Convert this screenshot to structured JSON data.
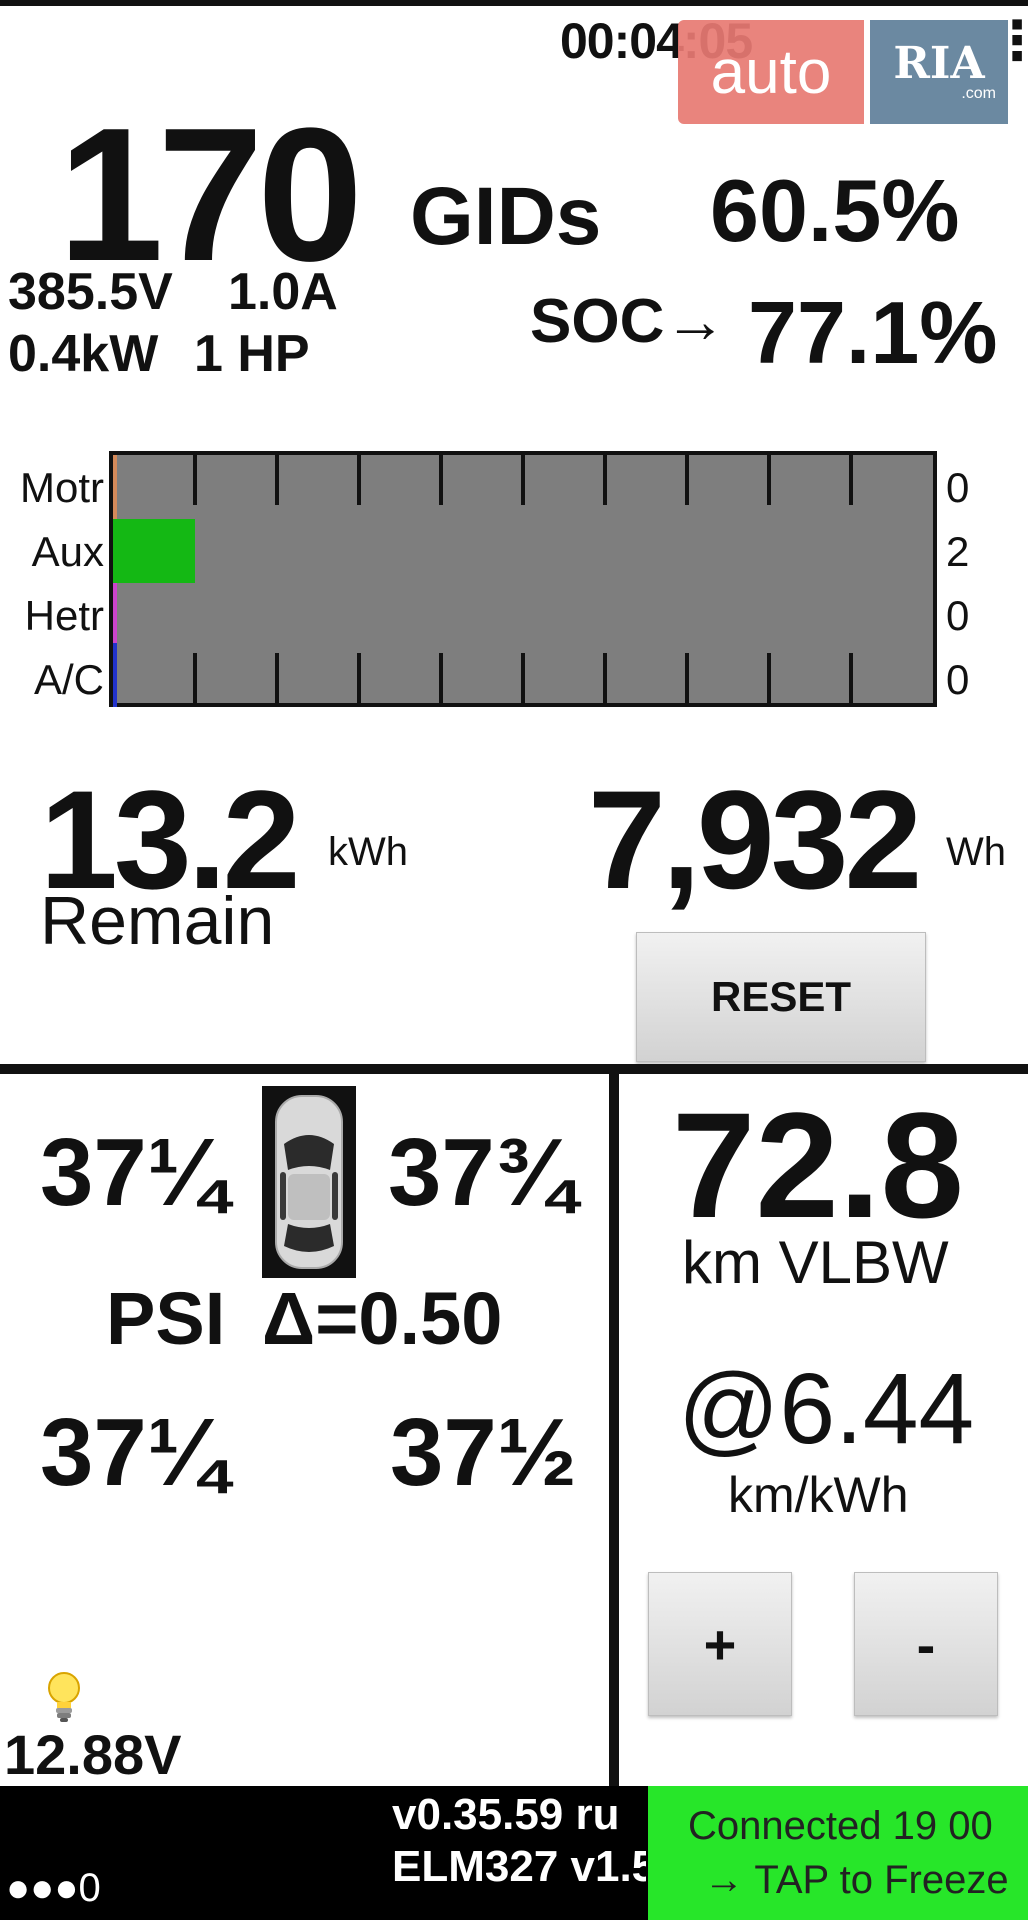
{
  "header": {
    "clock": "00:04:05",
    "menu_icon": "more-vert-icon",
    "watermark": {
      "left": "auto",
      "right": "RIA",
      "suffix": ".com"
    }
  },
  "battery": {
    "gids_value": "170",
    "gids_unit": "GIDs",
    "percent": "60.5%",
    "voltage": "385.5V",
    "current": "1.0A",
    "power_kw": "0.4kW",
    "power_hp": "1 HP",
    "soc_label": "SOC→",
    "soc_value": "77.1%"
  },
  "power_bars": {
    "rows": [
      {
        "label": "Motr",
        "value": "0",
        "fraction": 0.0,
        "color": "#d48a5a"
      },
      {
        "label": "Aux",
        "value": "2",
        "fraction": 0.1,
        "color": "#14b814"
      },
      {
        "label": "Hetr",
        "value": "0",
        "fraction": 0.0,
        "color": "#cc44cc"
      },
      {
        "label": "A/C",
        "value": "0",
        "fraction": 0.0,
        "color": "#2233cc"
      }
    ]
  },
  "energy": {
    "remain_value": "13.2",
    "remain_unit": "kWh",
    "remain_label": "Remain",
    "wh_value": "7,932",
    "wh_unit": "Wh",
    "reset_label": "RESET"
  },
  "tires": {
    "front_left": "37¼",
    "front_right": "37¾",
    "rear_left": "37¼",
    "rear_right": "37½",
    "psi_label": "PSI",
    "delta": "Δ=0.50",
    "car_icon": "car-top-view-icon"
  },
  "range": {
    "value": "72.8",
    "unit": "km VLBW",
    "efficiency": "@6.44",
    "efficiency_unit": "km/kWh",
    "plus_label": "+",
    "minus_label": "-"
  },
  "aux_battery": {
    "icon": "lightbulb-icon",
    "voltage": "12.88V"
  },
  "footer": {
    "version": "v0.35.59 ru",
    "adapter": "ELM327 v1.5",
    "dots": "●●●0",
    "connected_line1": "Connected 19 00",
    "connected_line2": "→ TAP to Freeze"
  },
  "colors": {
    "bar_background": "#7e7e7e",
    "connected_bg": "#27e629",
    "footer_bg": "#000000"
  }
}
